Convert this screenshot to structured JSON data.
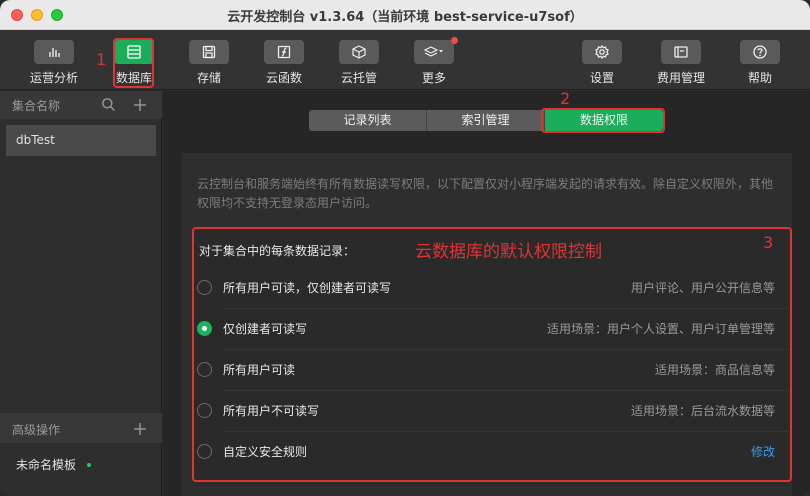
{
  "window": {
    "title": "云开发控制台 v1.3.64（当前环境 best-service-u7sof）"
  },
  "toolbar": {
    "items": [
      {
        "label": "运营分析",
        "icon": "bar-chart-icon"
      },
      {
        "label": "数据库",
        "icon": "database-icon",
        "active": true
      },
      {
        "label": "存储",
        "icon": "storage-icon"
      },
      {
        "label": "云函数",
        "icon": "function-icon"
      },
      {
        "label": "云托管",
        "icon": "cube-icon"
      },
      {
        "label": "更多",
        "icon": "layers-icon"
      },
      {
        "label": "设置",
        "icon": "gear-icon"
      },
      {
        "label": "费用管理",
        "icon": "card-icon"
      },
      {
        "label": "帮助",
        "icon": "help-icon"
      }
    ]
  },
  "sidebar": {
    "collections_header": "集合名称",
    "collections": [
      "dbTest"
    ],
    "advanced_header": "高级操作",
    "templates": [
      "未命名模板"
    ]
  },
  "tabs": [
    "记录列表",
    "索引管理",
    "数据权限"
  ],
  "active_tab": "数据权限",
  "permissions": {
    "notice": "云控制台和服务端始终有所有数据读写权限，以下配置仅对小程序端发起的请求有效。除自定义权限外，其他权限均不支持无登录态用户访问。",
    "heading": "对于集合中的每条数据记录：",
    "options": [
      {
        "name": "所有用户可读，仅创建者可读写",
        "desc": "用户评论、用户公开信息等",
        "selected": false
      },
      {
        "name": "仅创建者可读写",
        "desc": "适用场景：用户个人设置、用户订单管理等",
        "selected": true
      },
      {
        "name": "所有用户可读",
        "desc": "适用场景：商品信息等",
        "selected": false
      },
      {
        "name": "所有用户不可读写",
        "desc": "适用场景：后台流水数据等",
        "selected": false
      },
      {
        "name": "自定义安全规则",
        "link": "修改",
        "selected": false
      }
    ]
  },
  "annotations": {
    "n1": "1",
    "n2": "2",
    "n3": "3",
    "caption": "云数据库的默认权限控制",
    "color": "#e03434"
  },
  "colors": {
    "accent": "#1aad5a",
    "link": "#3d9bf0"
  }
}
